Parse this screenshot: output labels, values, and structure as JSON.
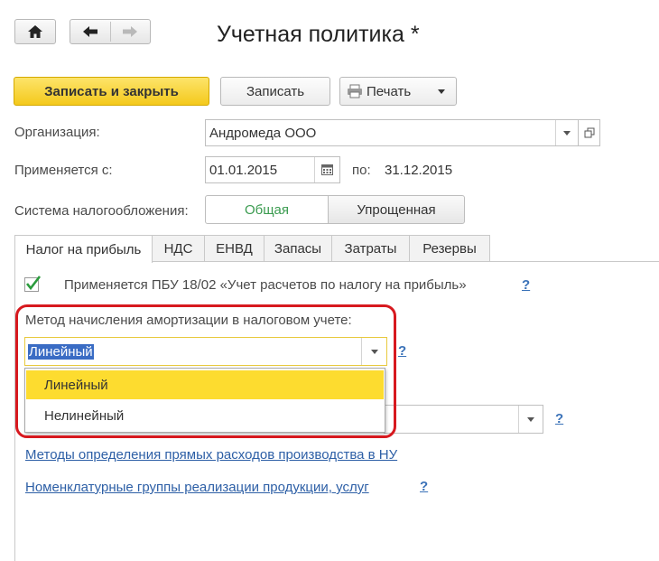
{
  "window": {
    "title": "Учетная политика *"
  },
  "toolbar": {
    "save_close_label": "Записать и закрыть",
    "save_label": "Записать",
    "print_label": "Печать"
  },
  "organization": {
    "label": "Организация:",
    "value": "Андромеда ООО"
  },
  "period": {
    "label": "Применяется с:",
    "from": "01.01.2015",
    "to_label": "по:",
    "to": "31.12.2015"
  },
  "tax_system": {
    "label": "Система налогообложения:",
    "options": [
      "Общая",
      "Упрощенная"
    ],
    "selected": "Общая"
  },
  "tabs": [
    {
      "label": "Налог на прибыль"
    },
    {
      "label": "НДС"
    },
    {
      "label": "ЕНВД"
    },
    {
      "label": "Запасы"
    },
    {
      "label": "Затраты"
    },
    {
      "label": "Резервы"
    }
  ],
  "pbu": {
    "label": "Применяется ПБУ 18/02 «Учет расчетов по налогу на прибыль»",
    "checked": true
  },
  "amortization": {
    "label": "Метод начисления амортизации в налоговом учете:",
    "value": "Линейный",
    "options": [
      "Линейный",
      "Нелинейный"
    ],
    "highlighted": "Линейный"
  },
  "help": "?",
  "links": {
    "direct_costs": "Методы определения прямых расходов производства в НУ",
    "nomenclature": "Номенклатурные группы реализации продукции, услуг"
  },
  "colors": {
    "primary_button": "#f6cd2a",
    "highlight_row": "#fddc2f",
    "callout": "#d7191f",
    "link": "#2d5fa6",
    "active_segment": "#3a9b4f"
  }
}
